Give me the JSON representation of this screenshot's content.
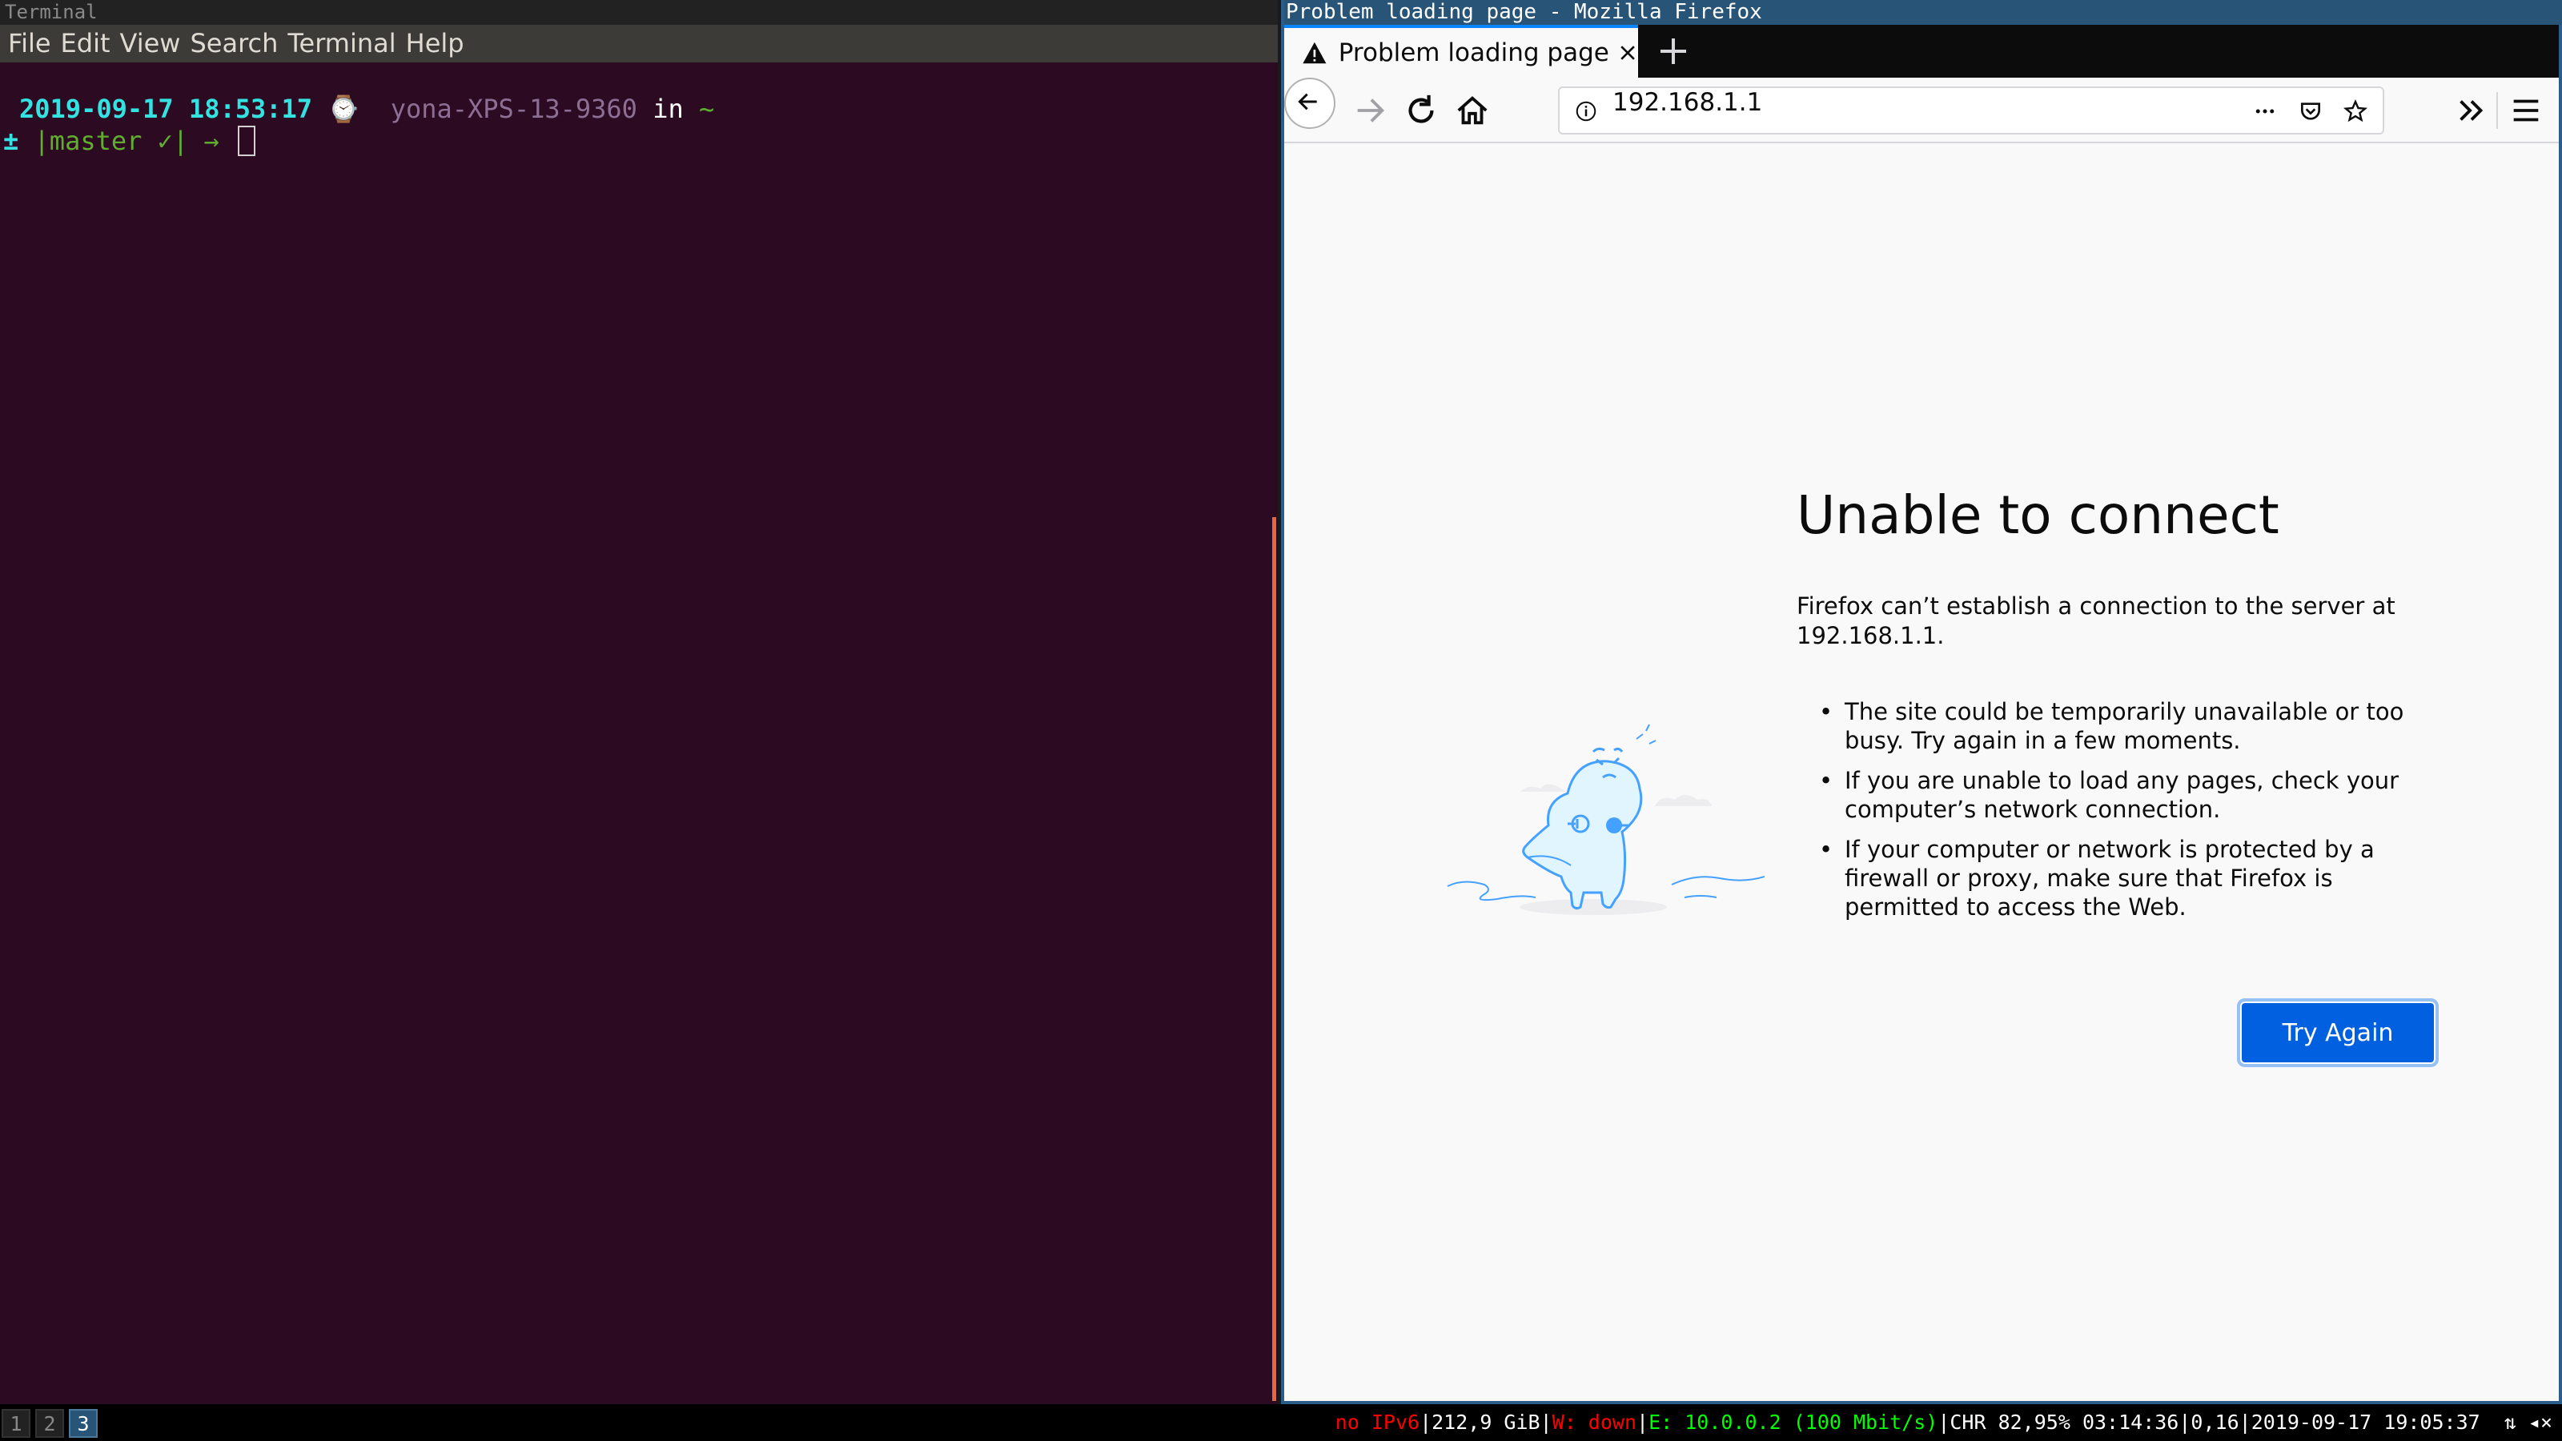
{
  "terminal": {
    "title": "Terminal",
    "menu": [
      "File",
      "Edit",
      "View",
      "Search",
      "Terminal",
      "Help"
    ],
    "prompt": {
      "datetime": "2019-09-17 18:53:17",
      "clock_glyph": "⌚",
      "host": "yona-XPS-13-9360",
      "in": "in",
      "dir": "~",
      "plusminus": "±",
      "branch": "|master ✓|",
      "arrow": "→"
    }
  },
  "firefox": {
    "window_title": "Problem loading page - Mozilla Firefox",
    "tab_title": "Problem loading page",
    "url": "192.168.1.1",
    "error": {
      "title": "Unable to connect",
      "description": "Firefox can’t establish a connection to the server at 192.168.1.1.",
      "bullets": [
        "The site could be temporarily unavailable or too busy. Try again in a few moments.",
        "If you are unable to load any pages, check your computer’s network connection.",
        "If your computer or network is protected by a firewall or proxy, make sure that Firefox is permitted to access the Web."
      ],
      "button": "Try Again"
    },
    "accent_color": "#0a84ff",
    "button_color": "#0060df"
  },
  "statusbar": {
    "workspaces": [
      "1",
      "2",
      "3"
    ],
    "active_workspace": "3",
    "ipv6": "no IPv6",
    "disk": "212,9 GiB",
    "wireless": "W: down",
    "ethernet": "E: 10.0.0.2 (100 Mbit/s)",
    "battery": "CHR 82,95% 03:14:36",
    "load": "0,16",
    "clock": "2019-09-17 19:05:37"
  }
}
